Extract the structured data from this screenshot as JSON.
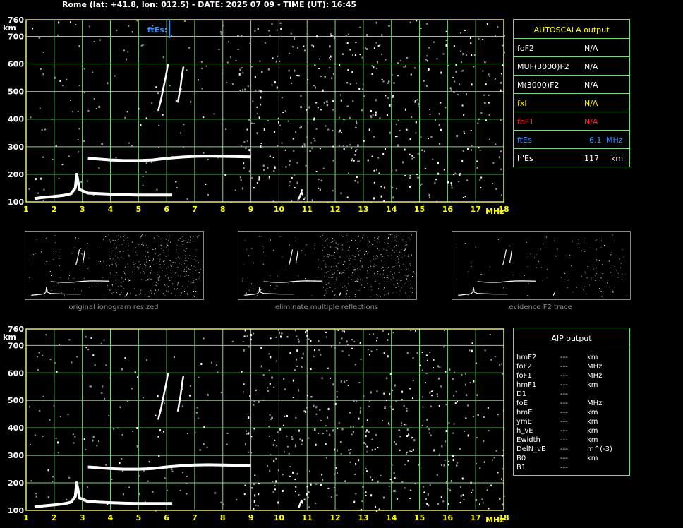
{
  "header": {
    "title": "Rome (lat: +41.8, lon: 012.5) - DATE: 2025 07 09 - TIME (UT): 16:45"
  },
  "colors": {
    "grid": "#7fd67f",
    "frame": "#e7e779",
    "tick_x": "#ffff00",
    "fte_label": "#3a8cff",
    "fxi": "#ffff00",
    "fof1": "#ff2020",
    "fte_value": "#3a8cff",
    "caption": "#8a8a8a"
  },
  "chart_data": [
    {
      "type": "scatter",
      "name": "ionogram-top",
      "title": "",
      "xlabel": "MHz",
      "ylabel": "km",
      "x_ticks": [
        "1",
        "2",
        "3",
        "4",
        "5",
        "6",
        "7",
        "8",
        "9",
        "10",
        "11",
        "12",
        "13",
        "14",
        "15",
        "16",
        "17",
        "18"
      ],
      "y_ticks": [
        "100",
        "200",
        "300",
        "400",
        "500",
        "600",
        "700",
        "760"
      ],
      "xlim": [
        1,
        18
      ],
      "ylim": [
        100,
        760
      ],
      "grid": true,
      "marker_label": "ftEs:",
      "marker_x": 6.1,
      "traces": [
        {
          "name": "E-layer trace",
          "x": [
            1.3,
            1.5,
            1.8,
            2.0,
            2.2,
            2.4,
            2.6,
            2.75,
            2.8,
            2.9,
            3.2,
            3.6,
            4.0,
            4.5,
            5.0,
            5.5,
            6.0,
            6.2
          ],
          "y": [
            112,
            115,
            118,
            120,
            122,
            125,
            130,
            150,
            200,
            145,
            132,
            130,
            128,
            126,
            125,
            125,
            125,
            125
          ]
        },
        {
          "name": "F-layer trace",
          "x": [
            3.2,
            3.6,
            4.0,
            4.5,
            5.0,
            5.5,
            6.0,
            6.5,
            7.0,
            7.5,
            8.0,
            8.5,
            9.0
          ],
          "y": [
            258,
            255,
            252,
            250,
            250,
            252,
            258,
            262,
            265,
            266,
            265,
            264,
            263
          ]
        },
        {
          "name": "Upper trace 1",
          "x": [
            5.7,
            5.8,
            5.9,
            6.0,
            6.05
          ],
          "y": [
            430,
            470,
            520,
            570,
            600
          ]
        },
        {
          "name": "Upper trace 2",
          "x": [
            6.4,
            6.5,
            6.55,
            6.6
          ],
          "y": [
            460,
            520,
            560,
            590
          ]
        },
        {
          "name": "Spike",
          "x": [
            10.7,
            10.8,
            10.85
          ],
          "y": [
            110,
            135,
            125
          ]
        }
      ]
    },
    {
      "type": "scatter",
      "name": "ionogram-bottom",
      "title": "",
      "xlabel": "MHz",
      "ylabel": "km",
      "x_ticks": [
        "1",
        "2",
        "3",
        "4",
        "5",
        "6",
        "7",
        "8",
        "9",
        "10",
        "11",
        "12",
        "13",
        "14",
        "15",
        "16",
        "17",
        "18"
      ],
      "y_ticks": [
        "100",
        "200",
        "300",
        "400",
        "500",
        "600",
        "700",
        "760"
      ],
      "xlim": [
        1,
        18
      ],
      "ylim": [
        100,
        760
      ],
      "grid": true
    }
  ],
  "autoscala": {
    "title": "AUTOSCALA output",
    "rows": [
      {
        "label": "foF2",
        "value": "N/A",
        "unit": ""
      },
      {
        "label": "MUF(3000)F2",
        "value": "N/A",
        "unit": ""
      },
      {
        "label": "M(3000)F2",
        "value": "N/A",
        "unit": ""
      },
      {
        "label": "fxI",
        "value": "N/A",
        "unit": ""
      },
      {
        "label": "foF1",
        "value": "N/A",
        "unit": ""
      },
      {
        "label": "ftEs",
        "value": "6.1",
        "unit": "MHz"
      },
      {
        "label": "h'Es",
        "value": "117",
        "unit": "km"
      }
    ]
  },
  "thumbnails": [
    {
      "caption": "original ionogram resized"
    },
    {
      "caption": "eliminate multiple reflections"
    },
    {
      "caption": "evidence F2 trace"
    }
  ],
  "aip": {
    "title": "AIP output",
    "rows": [
      {
        "label": "hmF2",
        "value": "---",
        "unit": "km"
      },
      {
        "label": "foF2",
        "value": "---",
        "unit": "MHz"
      },
      {
        "label": "foF1",
        "value": "---",
        "unit": "MHz"
      },
      {
        "label": "hmF1",
        "value": "---",
        "unit": "km"
      },
      {
        "label": "D1",
        "value": "---",
        "unit": ""
      },
      {
        "label": "foE",
        "value": "---",
        "unit": "MHz"
      },
      {
        "label": "hmE",
        "value": "---",
        "unit": "km"
      },
      {
        "label": "ymE",
        "value": "---",
        "unit": "km"
      },
      {
        "label": "h_vE",
        "value": "---",
        "unit": "km"
      },
      {
        "label": "Ewidth",
        "value": "---",
        "unit": "km"
      },
      {
        "label": "DelN_vE",
        "value": "---",
        "unit": "m^(-3)"
      },
      {
        "label": "B0",
        "value": "---",
        "unit": "km"
      },
      {
        "label": "B1",
        "value": "---",
        "unit": ""
      }
    ]
  }
}
